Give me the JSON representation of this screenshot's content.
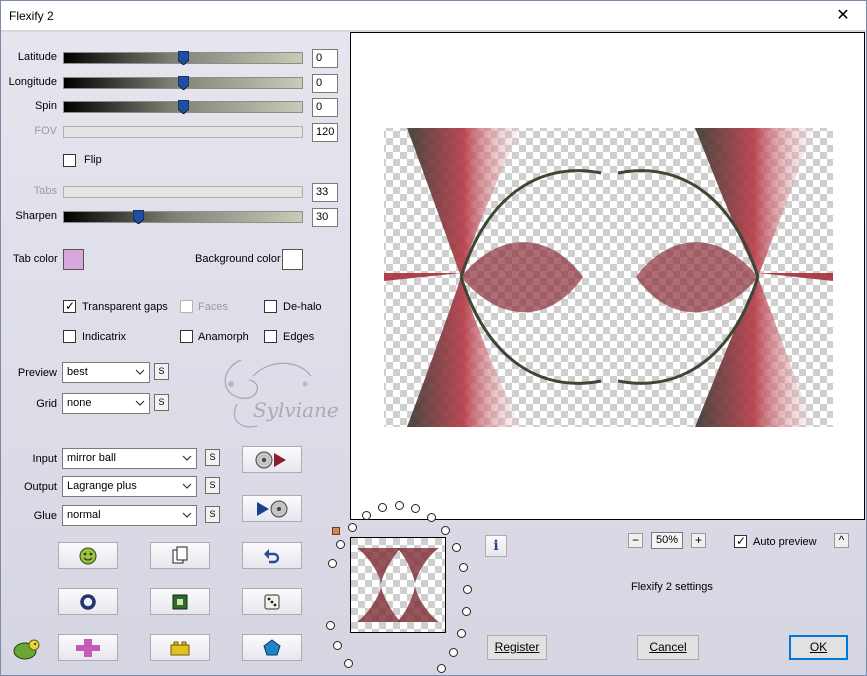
{
  "window": {
    "title": "Flexify 2"
  },
  "sliders": [
    {
      "label": "Latitude",
      "value": "0",
      "enabled": true,
      "level": 0.5
    },
    {
      "label": "Longitude",
      "value": "0",
      "enabled": true,
      "level": 0.5
    },
    {
      "label": "Spin",
      "value": "0",
      "enabled": true,
      "level": 0.5
    },
    {
      "label": "FOV",
      "value": "120",
      "enabled": false,
      "level": null
    },
    {
      "label": "Tabs",
      "value": "33",
      "enabled": false,
      "level": null
    },
    {
      "label": "Sharpen",
      "value": "30",
      "enabled": true,
      "level": 0.31
    }
  ],
  "flip": {
    "label": "Flip",
    "checked": false
  },
  "colors": {
    "tab_label": "Tab color",
    "tab_value": "#d8a8dc",
    "bg_label": "Background color",
    "bg_value": "#ffffff"
  },
  "options": {
    "transparent_gaps": {
      "label": "Transparent gaps",
      "checked": true
    },
    "faces": {
      "label": "Faces",
      "checked": false
    },
    "dehalo": {
      "label": "De-halo",
      "checked": false
    },
    "indicatrix": {
      "label": "Indicatrix",
      "checked": false
    },
    "anamorph": {
      "label": "Anamorph",
      "checked": false
    },
    "edges": {
      "label": "Edges",
      "checked": false
    }
  },
  "selects": {
    "preview": {
      "label": "Preview",
      "value": "best"
    },
    "grid": {
      "label": "Grid",
      "value": "none"
    },
    "input": {
      "label": "Input",
      "value": "mirror ball"
    },
    "output": {
      "label": "Output",
      "value": "Lagrange plus"
    },
    "glue": {
      "label": "Glue",
      "value": "normal"
    },
    "s_label": "S"
  },
  "watermark": {
    "text": "Sylviane"
  },
  "zoom": {
    "minus": "−",
    "value": "50%",
    "plus": "+"
  },
  "auto_preview": {
    "label": "Auto preview",
    "checked": true,
    "toggle": "^"
  },
  "info": "i",
  "settings_name": "Flexify 2 settings",
  "buttons": {
    "register": "Register",
    "cancel": "Cancel",
    "ok": "OK"
  },
  "accent": "#0078d7"
}
